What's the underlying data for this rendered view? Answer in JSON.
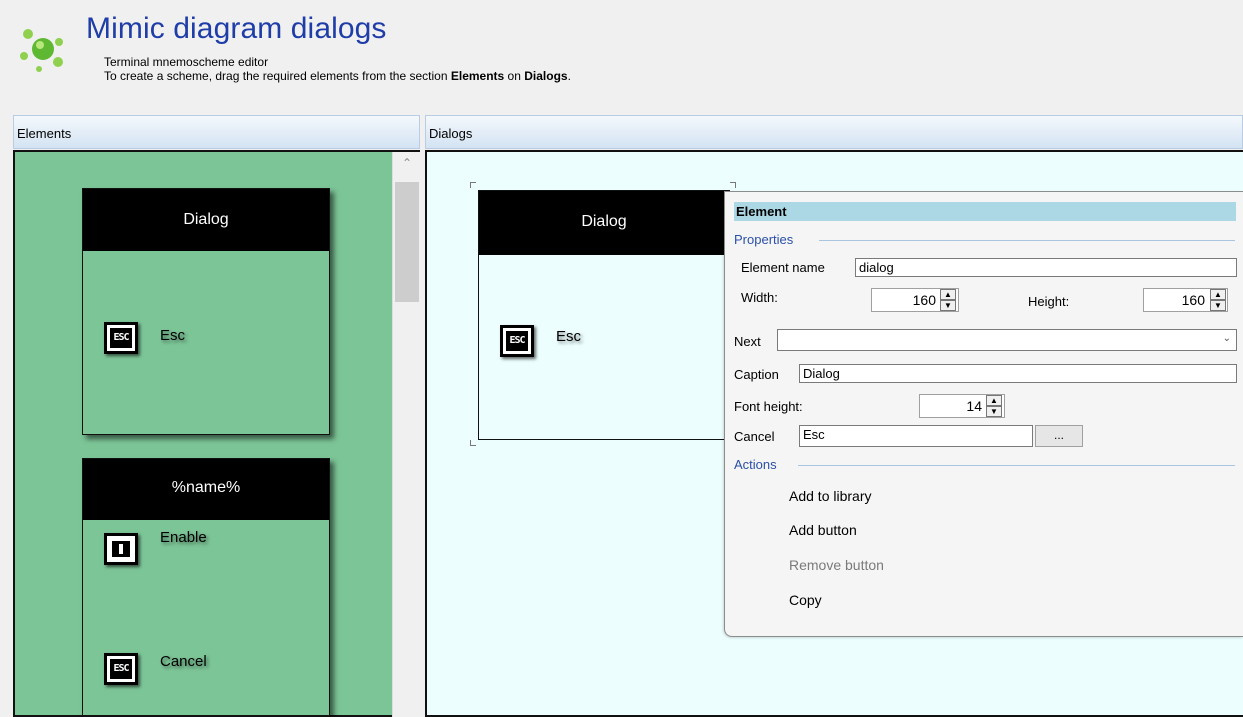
{
  "header": {
    "title": "Mimic diagram dialogs",
    "subtitle": "Terminal mnemoscheme editor",
    "instruction_pre": "To create a scheme, drag the required elements from the section ",
    "instruction_elements": "Elements",
    "instruction_mid": " on ",
    "instruction_dialogs": "Dialogs",
    "instruction_post": "."
  },
  "panels": {
    "elements_title": "Elements",
    "dialogs_title": "Dialogs"
  },
  "library": {
    "items": [
      {
        "header": "Dialog",
        "buttons": [
          {
            "icon": "esc-icon",
            "label": "Esc"
          }
        ]
      },
      {
        "header": "%name%",
        "buttons": [
          {
            "icon": "enable-icon",
            "label": "Enable"
          },
          {
            "icon": "esc-icon",
            "label": "Cancel"
          }
        ]
      }
    ]
  },
  "canvas": {
    "dialog": {
      "header": "Dialog",
      "button_label": "Esc",
      "button_icon": "esc-icon"
    }
  },
  "properties": {
    "title": "Element",
    "section_properties": "Properties",
    "element_name_label": "Element name",
    "element_name_value": "dialog",
    "width_label": "Width:",
    "width_value": "160",
    "height_label": "Height:",
    "height_value": "160",
    "next_label": "Next",
    "next_value": "",
    "caption_label": "Caption",
    "caption_value": "Dialog",
    "font_height_label": "Font height:",
    "font_height_value": "14",
    "cancel_label": "Cancel",
    "cancel_value": "Esc",
    "browse_label": "...",
    "section_actions": "Actions",
    "actions": [
      {
        "label": "Add to library",
        "enabled": true
      },
      {
        "label": "Add button",
        "enabled": true
      },
      {
        "label": "Remove button",
        "enabled": false
      },
      {
        "label": "Copy",
        "enabled": true
      }
    ]
  },
  "colors": {
    "title_blue": "#1f3da8",
    "elements_bg": "#7cc597",
    "dialogs_bg": "#ecfefe",
    "props_title_bg": "#acd8e6"
  }
}
